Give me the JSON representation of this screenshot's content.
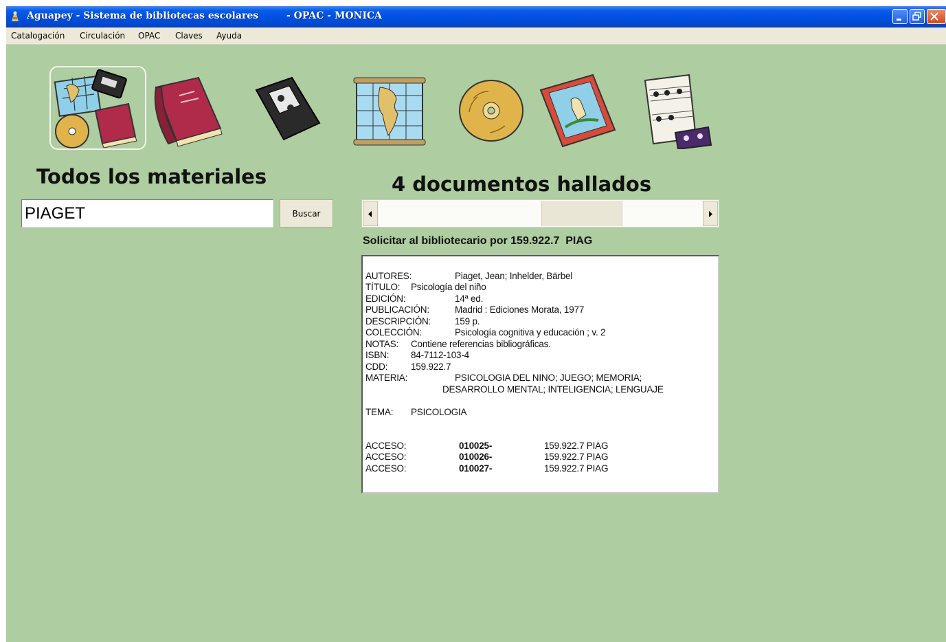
{
  "window": {
    "title": "Aguapey - Sistema de bibliotecas escolares",
    "subtitle": "- OPAC - MONICA",
    "accent": "#0a56e0"
  },
  "menu": [
    "Catalogación",
    "Circulación",
    "OPAC",
    "Claves",
    "Ayuda"
  ],
  "materials": {
    "icons": [
      "all-materials-icon",
      "book-icon",
      "video-cassette-icon",
      "map-icon",
      "compact-disc-icon",
      "magazine-icon",
      "sheet-music-icon"
    ],
    "selected": "all-materials-icon"
  },
  "search": {
    "heading": "Todos los materiales",
    "query": "PIAGET",
    "button_label": "Buscar"
  },
  "results": {
    "count_heading": "4 documentos hallados",
    "call_number_text": "Solicitar al bibliotecario por 159.922.7  PIAG"
  },
  "record": {
    "autores_label": "AUTORES:",
    "autores": "Piaget, Jean; Inhelder, Bärbel",
    "titulo_label": "TÍTULO:",
    "titulo": "Psicología del niño",
    "edicion_label": "EDICIÓN:",
    "edicion": "14ª ed.",
    "publicacion_label": "PUBLICACIÓN:",
    "publicacion": "Madrid : Ediciones Morata, 1977",
    "descripcion_label": "DESCRIPCIÓN:",
    "descripcion": "159 p.",
    "coleccion_label": "COLECCIÓN:",
    "coleccion": "Psicología cognitiva y educación ; v. 2",
    "notas_label": "NOTAS:",
    "notas": "Contiene referencias bibliográficas.",
    "isbn_label": "ISBN:",
    "isbn": "84-7112-103-4",
    "cdd_label": "CDD:",
    "cdd": "159.922.7",
    "materia_label": "MATERIA:",
    "materia_line1": "PSICOLOGIA DEL NINO; JUEGO; MEMORIA;",
    "materia_line2": "DESARROLLO MENTAL; INTELIGENCIA; LENGUAJE",
    "tema_label": "TEMA:",
    "tema": "PSICOLOGIA",
    "accesos": [
      {
        "label": "ACCESO:",
        "number": "010025-",
        "call": "159.922.7 PIAG"
      },
      {
        "label": "ACCESO:",
        "number": "010026-",
        "call": "159.922.7 PIAG"
      },
      {
        "label": "ACCESO:",
        "number": "010027-",
        "call": "159.922.7 PIAG"
      }
    ]
  }
}
